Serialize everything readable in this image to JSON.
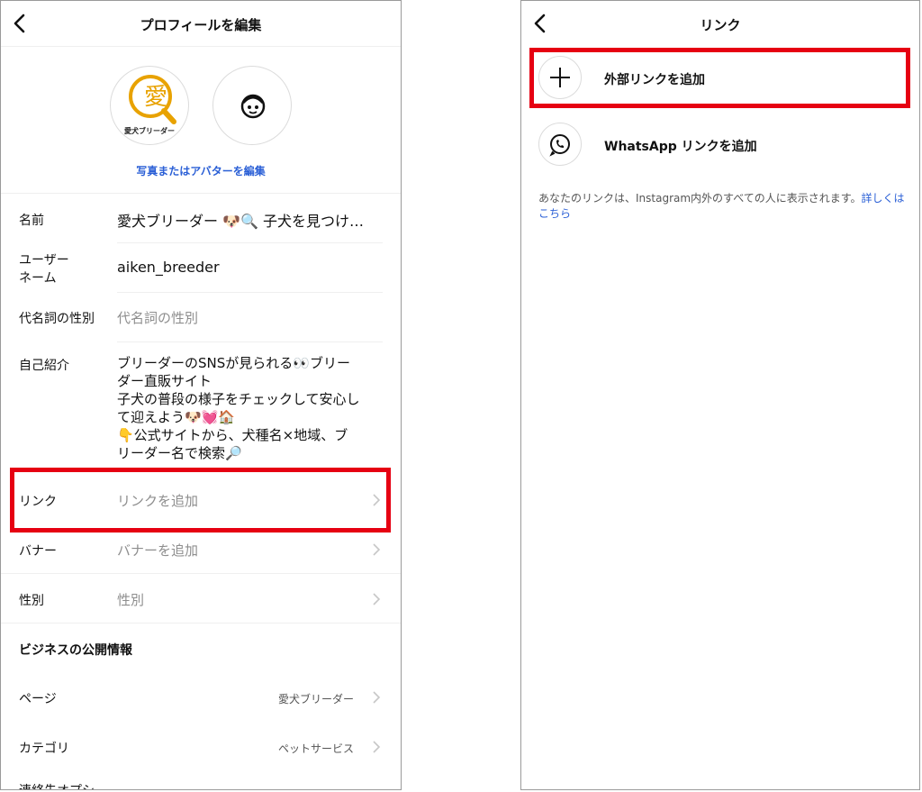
{
  "left": {
    "header": {
      "title": "プロフィールを編集"
    },
    "avatars": {
      "logo_text": "愛犬ブリーダー",
      "logo_mark": "愛"
    },
    "edit_photo_link": "写真またはアバターを編集",
    "fields": {
      "name": {
        "label": "名前",
        "value": "愛犬ブリーダー 🐶🔍 子犬を見つけ…"
      },
      "username": {
        "label_line1": "ユーザー",
        "label_line2": "ネーム",
        "value": "aiken_breeder"
      },
      "pronouns": {
        "label": "代名詞の性別",
        "placeholder": "代名詞の性別"
      },
      "bio": {
        "label": "自己紹介",
        "lines": [
          "ブリーダーのSNSが見られる👀ブリー",
          "ダー直販サイト",
          "子犬の普段の様子をチェックして安心し",
          "て迎えよう🐶💓🏠",
          "👇公式サイトから、犬種名×地域、ブ",
          "リーダー名で検索🔎"
        ]
      },
      "links": {
        "label": "リンク",
        "placeholder": "リンクを追加"
      },
      "banner": {
        "label": "バナー",
        "placeholder": "バナーを追加"
      },
      "gender": {
        "label": "性別",
        "placeholder": "性別"
      }
    },
    "business_section": {
      "title": "ビジネスの公開情報"
    },
    "business_rows": {
      "page": {
        "label": "ページ",
        "value": "愛犬ブリーダー"
      },
      "category": {
        "label": "カテゴリ",
        "value": "ペットサービス"
      }
    },
    "cutoff_text": "連絡先オプシ"
  },
  "right": {
    "header": {
      "title": "リンク"
    },
    "options": {
      "external": {
        "label": "外部リンクを追加"
      },
      "whatsapp": {
        "label": "WhatsApp リンクを追加"
      }
    },
    "info_text": "あなたのリンクは、Instagram内外のすべての人に表示されます。",
    "info_link": "詳しくはこちら"
  },
  "colors": {
    "highlight": "#e60012",
    "link_blue": "#2a5fd6",
    "divider": "#efefef",
    "placeholder": "#8e8e8e"
  },
  "icons": [
    "back-icon",
    "chevron-right-icon",
    "plus-icon",
    "whatsapp-icon",
    "avatar-face-icon"
  ]
}
